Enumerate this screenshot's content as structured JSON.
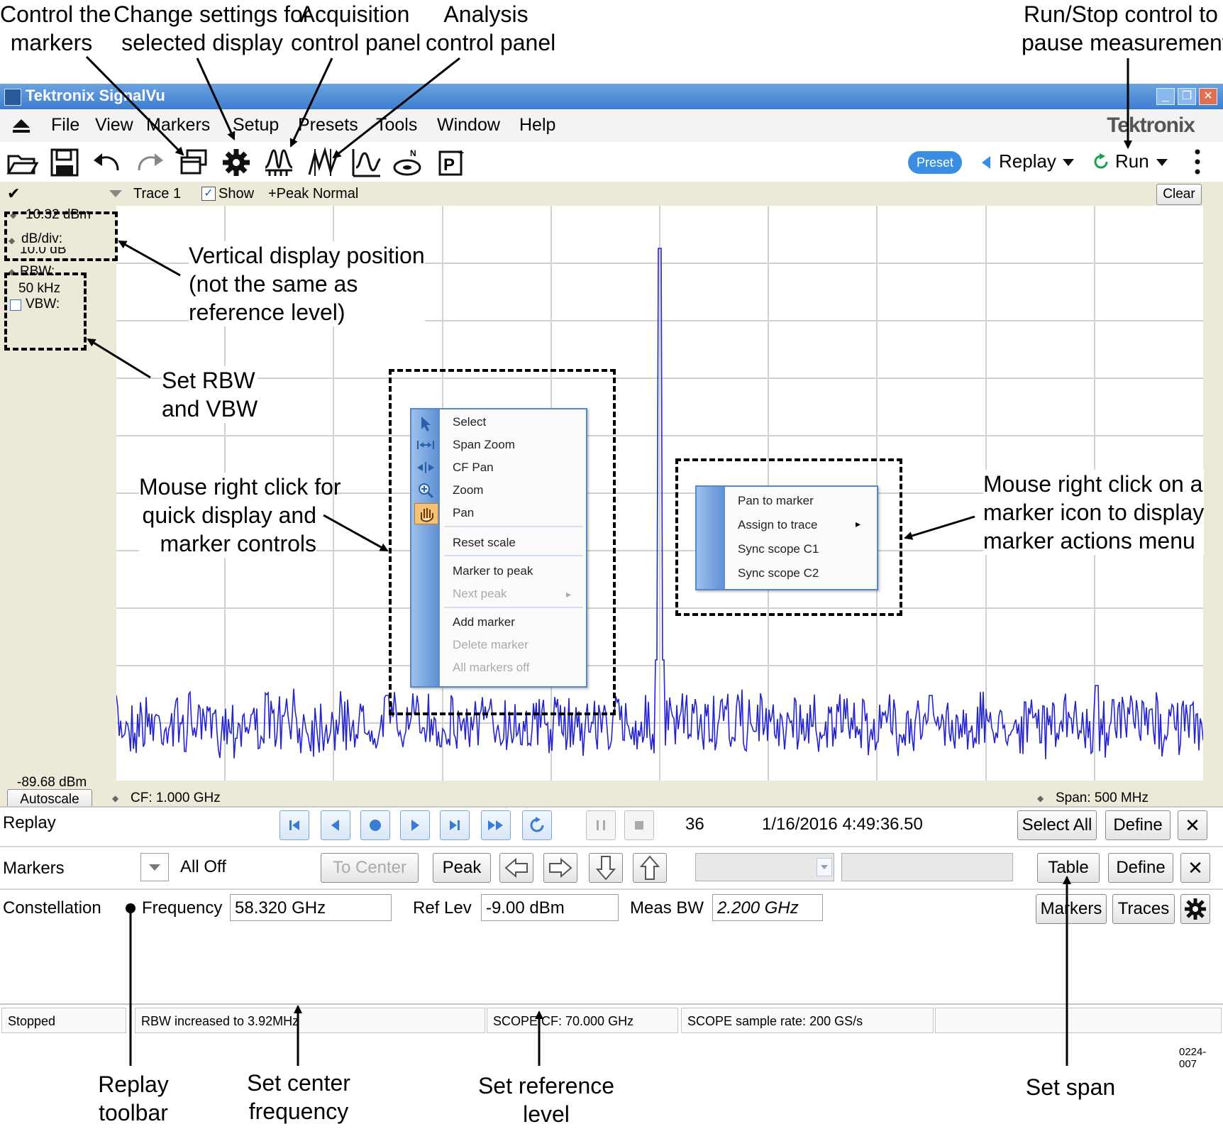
{
  "callouts": {
    "control_markers": "Control the\nmarkers",
    "change_settings": "Change settings for\nselected display",
    "acquisition": "Acquisition\ncontrol panel",
    "analysis": "Analysis\ncontrol panel",
    "run_stop": "Run/Stop control to\npause measurement",
    "vertical_position": "Vertical display position\n(not the same as\nreference level)",
    "set_rbw_vbw": "Set RBW\nand VBW",
    "right_click_display": "Mouse right click for\nquick display and\nmarker controls",
    "right_click_marker": "Mouse right click on a\nmarker icon to display\nmarker actions menu",
    "replay_toolbar": "Replay\ntoolbar",
    "set_center_freq": "Set center\nfrequency",
    "set_ref_level": "Set reference\nlevel",
    "set_span": "Set span",
    "figure_id": "0224-007"
  },
  "window": {
    "title": "Tektronix SignalVu",
    "brand": "Tektronix",
    "controls": [
      "_",
      "❐",
      "✕"
    ]
  },
  "menu": [
    "File",
    "View",
    "Markers",
    "Setup",
    "Presets",
    "Tools",
    "Window",
    "Help"
  ],
  "toolbar": {
    "icons": [
      "open-folder-icon",
      "save-icon",
      "undo-icon",
      "redo-icon",
      "displays-icon",
      "settings-gear-icon",
      "acquisition-icon",
      "analysis-icon",
      "amplitude-icon",
      "vna-icon",
      "preset-p-icon"
    ],
    "preset": "Preset",
    "replay": "Replay",
    "run": "Run"
  },
  "trace_bar": {
    "check": "✔",
    "trace": "Trace 1",
    "show": "Show",
    "detector": "+Peak Normal",
    "clear": "Clear"
  },
  "left_panel": {
    "top_level": "10.32 dBm",
    "db_div_label": "dB/div:",
    "db_div_value": "10.0 dB",
    "rbw_label": "RBW:",
    "rbw_value": "50 kHz",
    "vbw_label": "VBW:",
    "bottom_level": "-89.68 dBm",
    "autoscale": "Autoscale"
  },
  "plot": {
    "cf": "CF: 1.000 GHz",
    "span": "Span: 500 MHz"
  },
  "display_menu": [
    {
      "label": "Select",
      "icon": "arrow-pointer-icon",
      "enabled": true
    },
    {
      "label": "Span Zoom",
      "icon": "span-zoom-icon",
      "enabled": true
    },
    {
      "label": "CF Pan",
      "icon": "cf-pan-icon",
      "enabled": true
    },
    {
      "label": "Zoom",
      "icon": "zoom-icon",
      "enabled": true
    },
    {
      "label": "Pan",
      "icon": "hand-pan-icon",
      "enabled": true
    },
    {
      "label": "Reset scale",
      "enabled": true
    },
    {
      "label": "Marker to peak",
      "enabled": true
    },
    {
      "label": "Next peak",
      "enabled": false
    },
    {
      "label": "Add marker",
      "enabled": true
    },
    {
      "label": "Delete marker",
      "enabled": false
    },
    {
      "label": "All markers off",
      "enabled": false
    }
  ],
  "marker_menu": [
    "Pan to marker",
    "Assign to trace",
    "Sync scope C1",
    "Sync scope C2"
  ],
  "replay_row": {
    "label": "Replay",
    "count": "36",
    "timestamp": "1/16/2016 4:49:36.50",
    "select_all": "Select All",
    "define": "Define",
    "close": "✕"
  },
  "markers_row": {
    "label": "Markers",
    "mode": "All Off",
    "to_center": "To Center",
    "peak": "Peak",
    "table": "Table",
    "define": "Define",
    "close": "✕"
  },
  "constellation_row": {
    "label": "Constellation",
    "freq_label": "Frequency",
    "freq_value": "58.320 GHz",
    "ref_label": "Ref Lev",
    "ref_value": "-9.00 dBm",
    "meas_label": "Meas BW",
    "meas_value": "2.200 GHz",
    "markers_btn": "Markers",
    "traces_btn": "Traces"
  },
  "status": {
    "state": "Stopped",
    "message": "RBW increased to 3.92MHz",
    "scope_cf": "SCOPE CF: 70.000 GHz",
    "scope_rate": "SCOPE sample rate: 200 GS/s"
  }
}
